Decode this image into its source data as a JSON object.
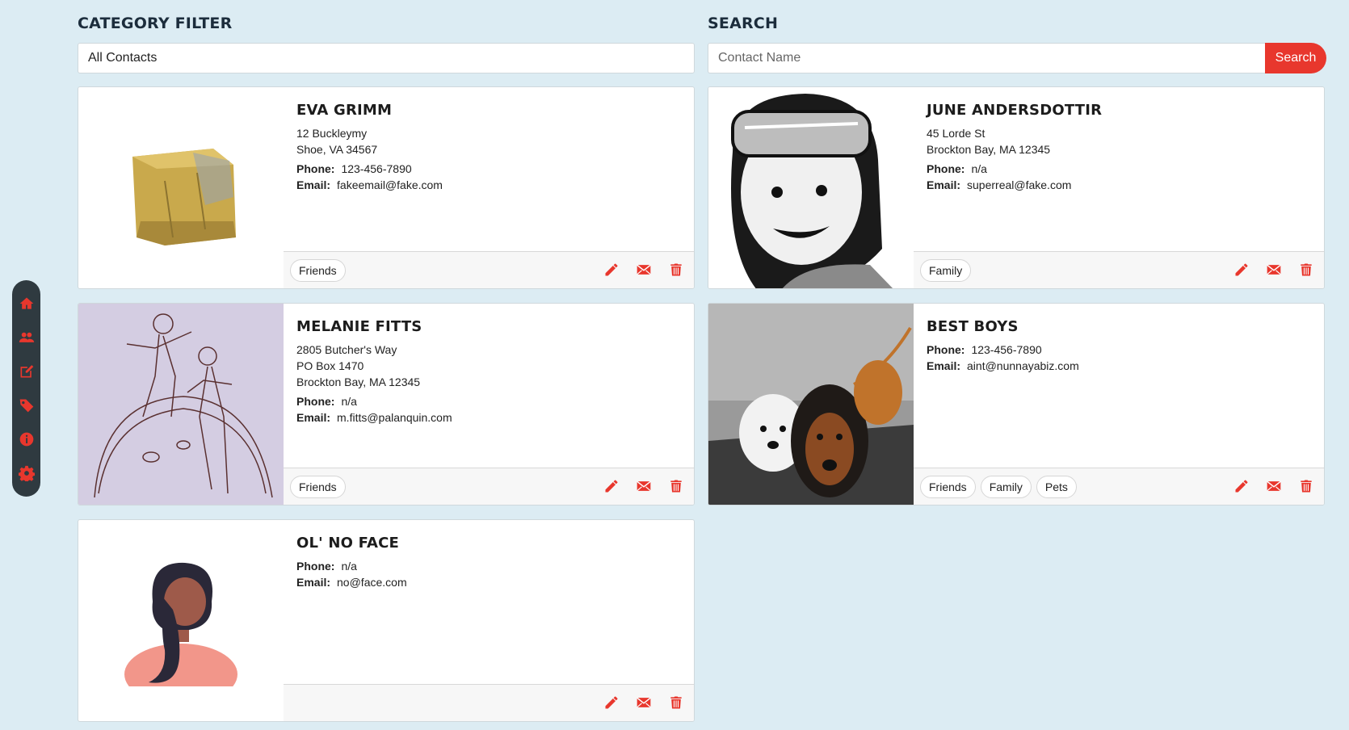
{
  "colors": {
    "accent": "#e8372d",
    "background": "#dcecf3",
    "sidebar": "#2f3a40"
  },
  "sidebar": {
    "items": [
      {
        "icon": "home-icon"
      },
      {
        "icon": "contacts-icon"
      },
      {
        "icon": "edit-icon"
      },
      {
        "icon": "tag-icon"
      },
      {
        "icon": "info-icon"
      },
      {
        "icon": "gear-icon"
      }
    ]
  },
  "filter": {
    "title": "CATEGORY FILTER",
    "value": "All Contacts"
  },
  "search": {
    "title": "SEARCH",
    "placeholder": "Contact Name",
    "button_label": "Search"
  },
  "labels": {
    "phone": "Phone:",
    "email": "Email:"
  },
  "contacts": [
    {
      "name": "EVA GRIMM",
      "address": [
        "12 Buckleymy",
        "Shoe, VA 34567"
      ],
      "phone": "123-456-7890",
      "email": "fakeemail@fake.com",
      "tags": [
        "Friends"
      ],
      "photo": "yellow-rock"
    },
    {
      "name": "JUNE ANDERSDOTTIR",
      "address": [
        "45 Lorde St",
        "Brockton Bay, MA 12345"
      ],
      "phone": "n/a",
      "email": "superreal@fake.com",
      "tags": [
        "Family"
      ],
      "photo": "comic-girl-sketch"
    },
    {
      "name": "MELANIE FITTS",
      "address": [
        "2805 Butcher's Way",
        "PO Box 1470",
        "Brockton Bay, MA 12345"
      ],
      "phone": "n/a",
      "email": "m.fitts@palanquin.com",
      "tags": [
        "Friends"
      ],
      "photo": "pencil-sketch-lavender"
    },
    {
      "name": "BEST BOYS",
      "address": [],
      "phone": "123-456-7890",
      "email": "aint@nunnayabiz.com",
      "tags": [
        "Friends",
        "Family",
        "Pets"
      ],
      "photo": "two-dogs"
    },
    {
      "name": "OL' NO FACE",
      "address": [],
      "phone": "n/a",
      "email": "no@face.com",
      "tags": [],
      "photo": "default-avatar"
    }
  ]
}
